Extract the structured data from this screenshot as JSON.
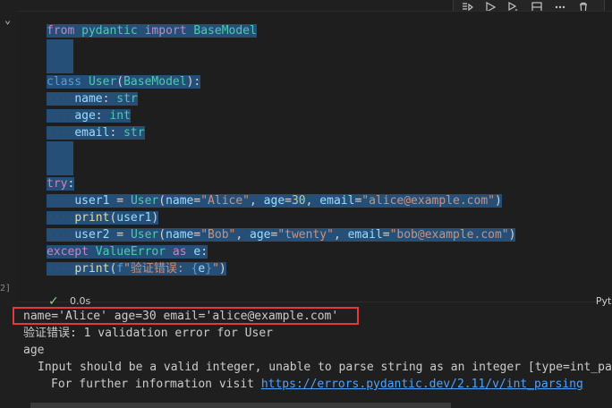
{
  "toolbar": {
    "icons": [
      "run-above-icon",
      "run-cell-icon",
      "run-below-icon",
      "split-cell-icon",
      "more-icon",
      "delete-icon"
    ]
  },
  "cell": {
    "lines": [
      [
        [
          "kw",
          "from"
        ],
        [
          "pun",
          " "
        ],
        [
          "cls",
          "pydantic"
        ],
        [
          "pun",
          " "
        ],
        [
          "kw",
          "import"
        ],
        [
          "pun",
          " "
        ],
        [
          "cls",
          "BaseModel"
        ]
      ],
      [],
      [],
      [
        [
          "kw2",
          "class"
        ],
        [
          "pun",
          " "
        ],
        [
          "cls",
          "User"
        ],
        [
          "pun",
          "("
        ],
        [
          "cls",
          "BaseModel"
        ],
        [
          "pun",
          "):"
        ]
      ],
      [
        [
          "ind",
          "    "
        ],
        [
          "var",
          "name"
        ],
        [
          "pun",
          ": "
        ],
        [
          "cls",
          "str"
        ]
      ],
      [
        [
          "ind",
          "    "
        ],
        [
          "var",
          "age"
        ],
        [
          "pun",
          ": "
        ],
        [
          "cls",
          "int"
        ]
      ],
      [
        [
          "ind",
          "    "
        ],
        [
          "var",
          "email"
        ],
        [
          "pun",
          ": "
        ],
        [
          "cls",
          "str"
        ]
      ],
      [],
      [],
      [
        [
          "kw",
          "try"
        ],
        [
          "pun",
          ":"
        ]
      ],
      [
        [
          "ind",
          "    "
        ],
        [
          "var",
          "user1"
        ],
        [
          "pun",
          " = "
        ],
        [
          "cls",
          "User"
        ],
        [
          "pun",
          "("
        ],
        [
          "var",
          "name"
        ],
        [
          "pun",
          "="
        ],
        [
          "str",
          "\"Alice\""
        ],
        [
          "pun",
          ", "
        ],
        [
          "var",
          "age"
        ],
        [
          "pun",
          "="
        ],
        [
          "num",
          "30"
        ],
        [
          "pun",
          ", "
        ],
        [
          "var",
          "email"
        ],
        [
          "pun",
          "="
        ],
        [
          "str",
          "\"alice@example.com\""
        ],
        [
          "pun",
          ")"
        ]
      ],
      [
        [
          "ind",
          "    "
        ],
        [
          "fn",
          "print"
        ],
        [
          "pun",
          "("
        ],
        [
          "var",
          "user1"
        ],
        [
          "pun",
          ")"
        ]
      ],
      [
        [
          "ind",
          "    "
        ],
        [
          "var",
          "user2"
        ],
        [
          "pun",
          " = "
        ],
        [
          "cls",
          "User"
        ],
        [
          "pun",
          "("
        ],
        [
          "var",
          "name"
        ],
        [
          "pun",
          "="
        ],
        [
          "str",
          "\"Bob\""
        ],
        [
          "pun",
          ", "
        ],
        [
          "var",
          "age"
        ],
        [
          "pun",
          "="
        ],
        [
          "str",
          "\"twenty\""
        ],
        [
          "pun",
          ", "
        ],
        [
          "var",
          "email"
        ],
        [
          "pun",
          "="
        ],
        [
          "str",
          "\"bob@example.com\""
        ],
        [
          "pun",
          ")"
        ]
      ],
      [
        [
          "kw",
          "except"
        ],
        [
          "pun",
          " "
        ],
        [
          "cls",
          "ValueError"
        ],
        [
          "pun",
          " "
        ],
        [
          "kw",
          "as"
        ],
        [
          "pun",
          " "
        ],
        [
          "var",
          "e"
        ],
        [
          "pun",
          ":"
        ]
      ],
      [
        [
          "ind",
          "    "
        ],
        [
          "fn",
          "print"
        ],
        [
          "pun",
          "("
        ],
        [
          "kw2",
          "f"
        ],
        [
          "str",
          "\"验证错误: "
        ],
        [
          "kw2",
          "{"
        ],
        [
          "var",
          "e"
        ],
        [
          "kw2",
          "}"
        ],
        [
          "str",
          "\""
        ],
        [
          "pun",
          ")"
        ]
      ]
    ],
    "exec_count": "2]",
    "status_time": "0.0s",
    "language": "Python"
  },
  "output": {
    "line1": "name='Alice' age=30 email='alice@example.com'",
    "line2": "验证错误: 1 validation error for User",
    "line3": "age",
    "line4": "Input should be a valid integer, unable to parse string as an integer [type=int_pars",
    "line5_prefix": "For further information visit ",
    "line5_link": "https://errors.pydantic.dev/2.11/v/int_parsing"
  }
}
